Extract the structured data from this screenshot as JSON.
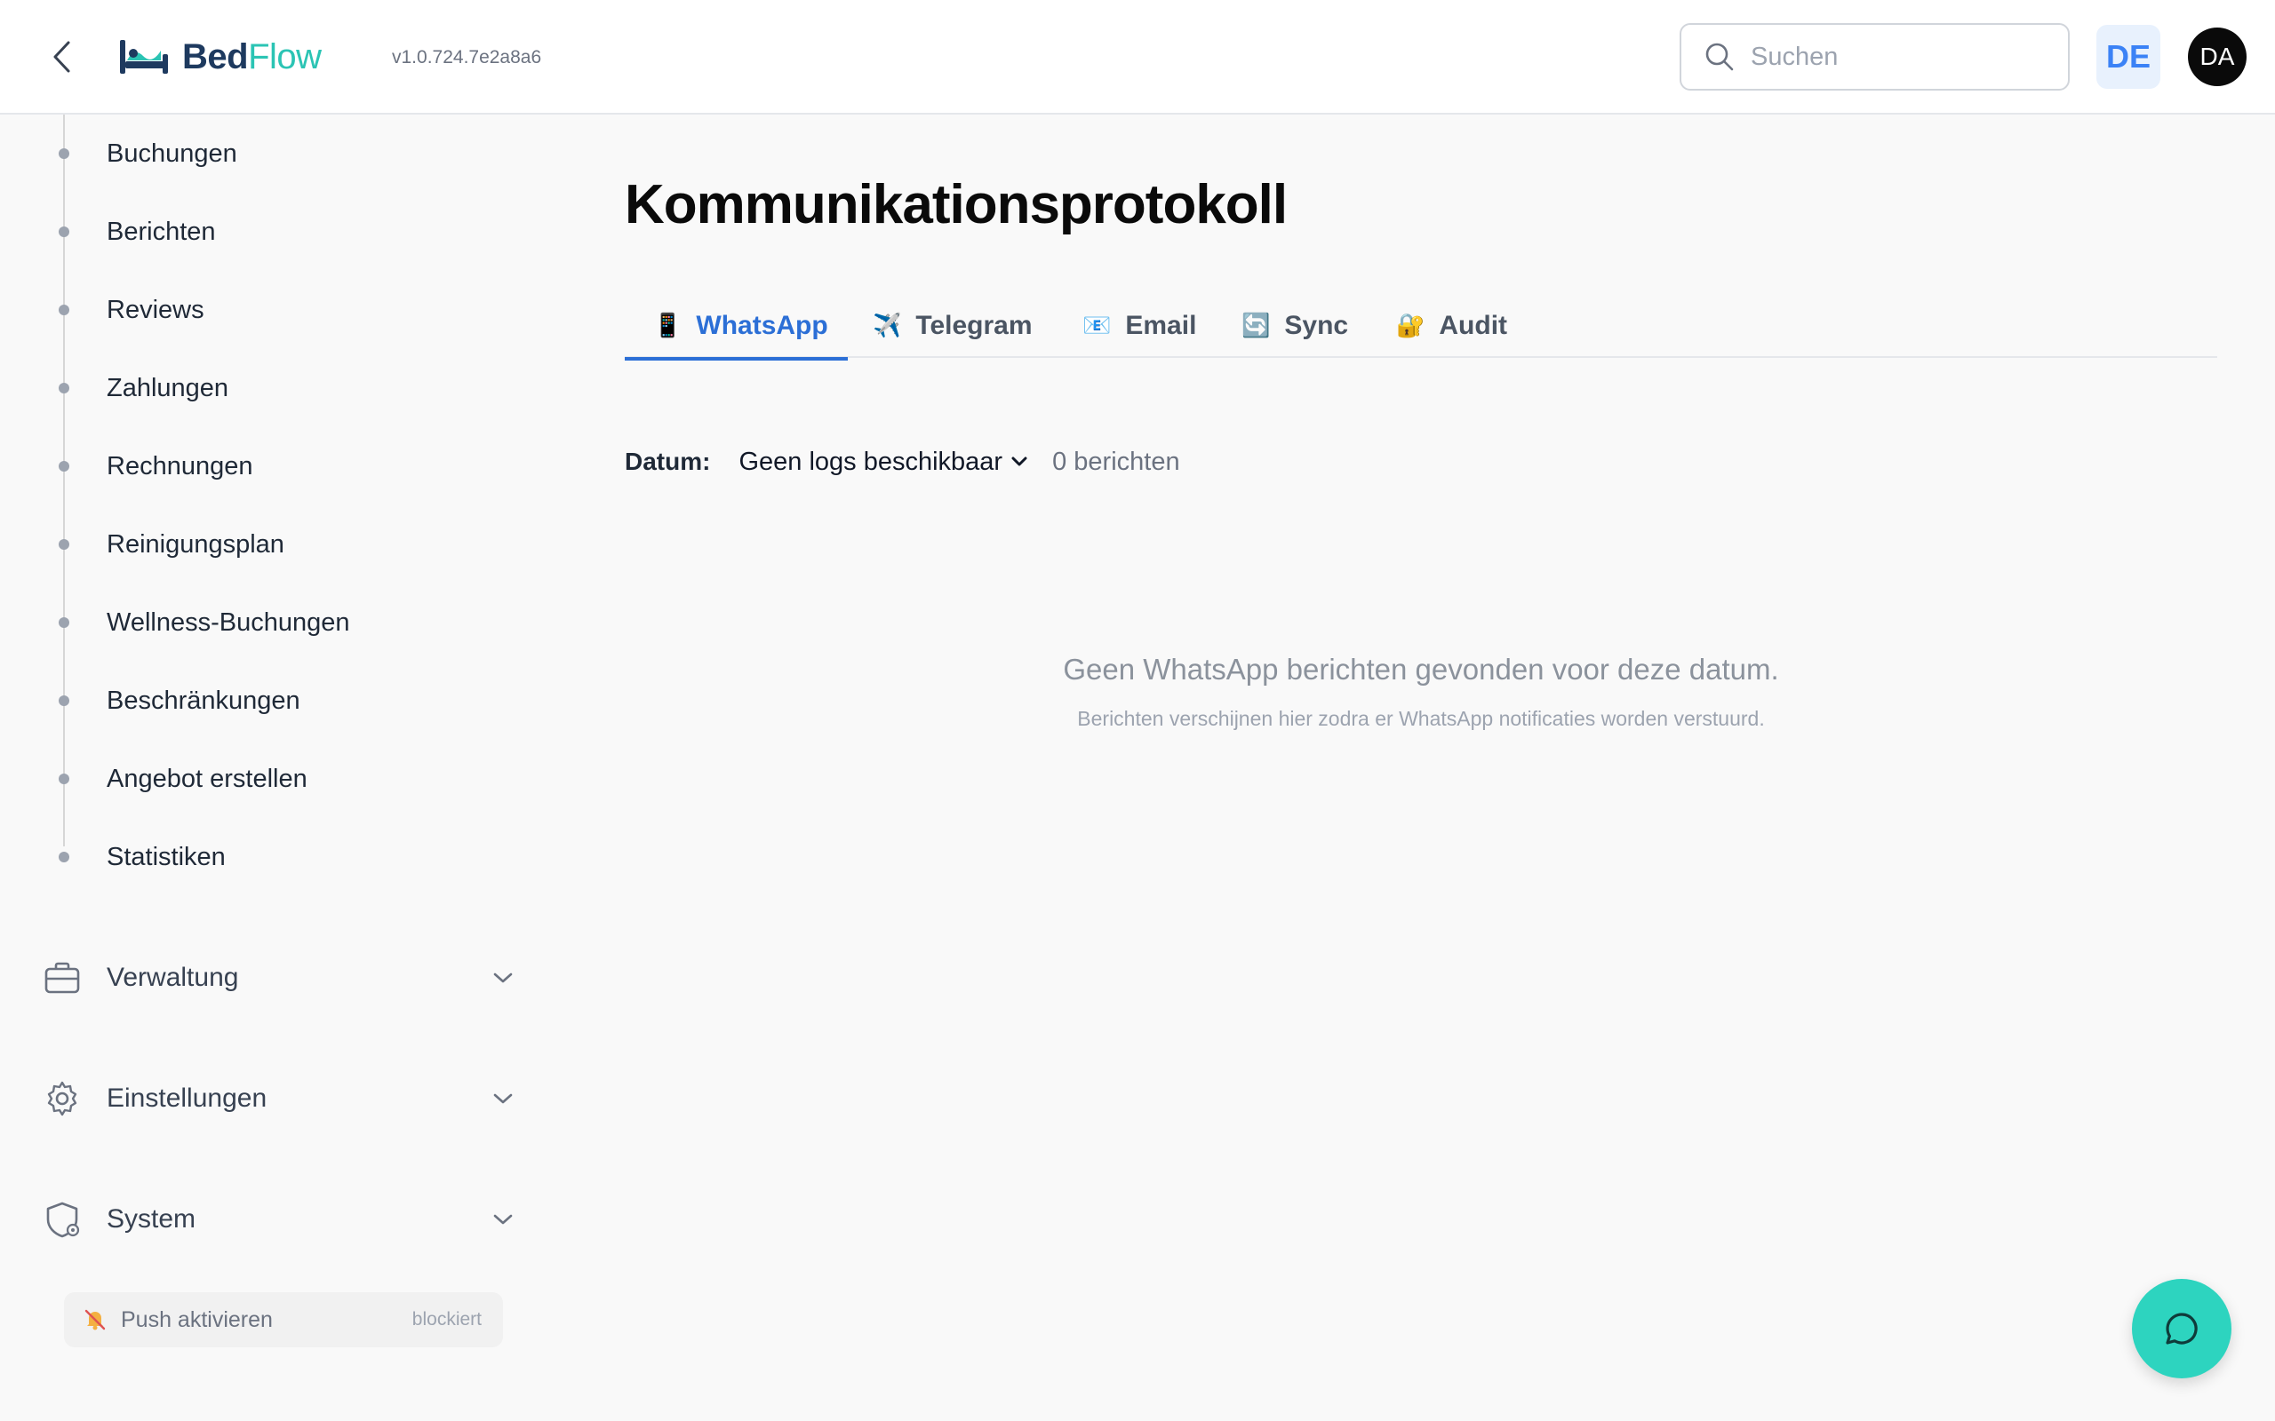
{
  "header": {
    "logo_bed": "Bed",
    "logo_flow": "Flow",
    "version": "v1.0.724.7e2a8a6",
    "search_placeholder": "Suchen",
    "language": "DE",
    "avatar_initials": "DA"
  },
  "sidebar": {
    "sub_items": [
      {
        "label": "Buchungen"
      },
      {
        "label": "Berichten"
      },
      {
        "label": "Reviews"
      },
      {
        "label": "Zahlungen"
      },
      {
        "label": "Rechnungen"
      },
      {
        "label": "Reinigungsplan"
      },
      {
        "label": "Wellness-Buchungen"
      },
      {
        "label": "Beschränkungen"
      },
      {
        "label": "Angebot erstellen"
      },
      {
        "label": "Statistiken"
      }
    ],
    "groups": [
      {
        "label": "Verwaltung",
        "icon": "briefcase-icon"
      },
      {
        "label": "Einstellungen",
        "icon": "gear-icon"
      },
      {
        "label": "System",
        "icon": "shield-gear-icon"
      }
    ],
    "push": {
      "label": "Push aktivieren",
      "status": "blockiert",
      "icon": "bell-off-icon"
    }
  },
  "main": {
    "title": "Kommunikationsprotokoll",
    "tabs": [
      {
        "label": "WhatsApp",
        "emoji": "📱",
        "active": true
      },
      {
        "label": "Telegram",
        "emoji": "✈️",
        "active": false
      },
      {
        "label": "Email",
        "emoji": "📧",
        "active": false
      },
      {
        "label": "Sync",
        "emoji": "🔄",
        "active": false
      },
      {
        "label": "Audit",
        "emoji": "🔐",
        "active": false
      }
    ],
    "filter": {
      "label": "Datum:",
      "selected": "Geen logs beschikbaar",
      "count": "0 berichten"
    },
    "empty": {
      "title": "Geen WhatsApp berichten gevonden voor deze datum.",
      "subtitle": "Berichten verschijnen hier zodra er WhatsApp notificaties worden verstuurd."
    }
  },
  "colors": {
    "accent": "#2c6fd6",
    "brand_dark": "#1e3a5f",
    "brand_teal": "#2bc4b4",
    "fab": "#2dd4bf"
  }
}
